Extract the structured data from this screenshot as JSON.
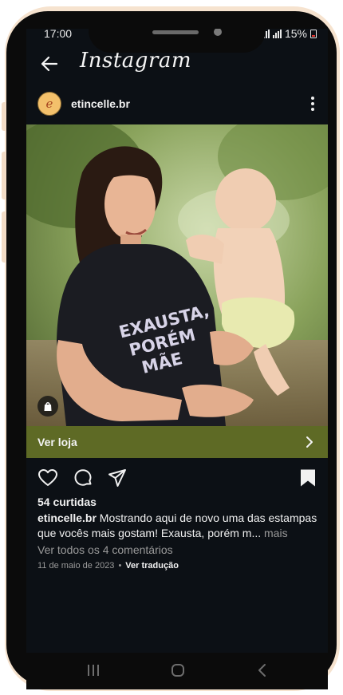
{
  "status_bar": {
    "time": "17:00",
    "battery": "15%"
  },
  "header": {
    "app_title": "Instagram",
    "back_icon": "arrow-left-icon"
  },
  "post": {
    "username": "etincelle.br",
    "avatar_letter": "e",
    "image": {
      "shirt_line_1": "EXAUSTA,",
      "shirt_line_2": "PORÉM",
      "shirt_line_3": "MÃE"
    },
    "shop_label": "Ver loja",
    "likes": "54 curtidas",
    "caption_user": "etincelle.br",
    "caption_text": " Mostrando aqui de novo uma das estampas que vocês mais gostam! Exausta, porém m...",
    "caption_more": " mais",
    "comments_link": "Ver todos os 4 comentários",
    "date": "11 de maio de 2023",
    "date_separator": "•",
    "translate_link": "Ver tradução"
  },
  "colors": {
    "background": "#0c1015",
    "shop_bar": "#5e6a25",
    "text": "#f1f1f1",
    "muted_text": "#9a9a9a",
    "frame": "#f6e3cf"
  },
  "icons": [
    "arrow-left-icon",
    "more-vertical-icon",
    "shopping-bag-icon",
    "chevron-right-icon",
    "heart-icon",
    "comment-icon",
    "share-icon",
    "bookmark-icon",
    "recent-apps-icon",
    "home-icon",
    "back-nav-icon"
  ]
}
